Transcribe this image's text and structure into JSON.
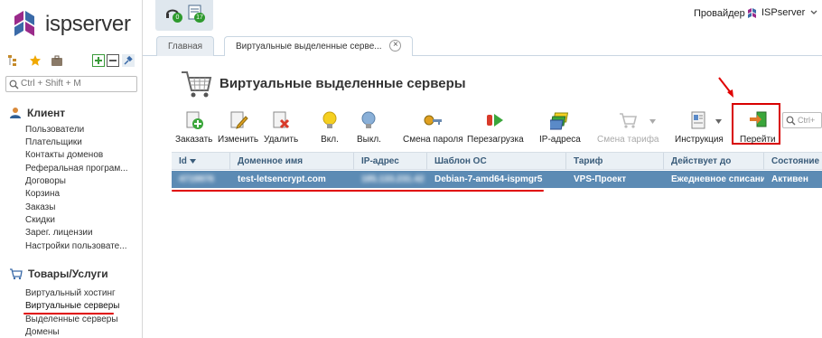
{
  "app": {
    "logo_text": "ispserver",
    "accent": "#7a1a7a"
  },
  "header": {
    "notify_badges": [
      "0",
      "17"
    ],
    "provider_label": "Провайдер",
    "brand_label": "ISPserver"
  },
  "tabs": [
    {
      "label": "Главная"
    },
    {
      "label": "Виртуальные выделенные серве..."
    }
  ],
  "sidebar": {
    "search_placeholder": "Ctrl + Shift + M",
    "sections": [
      {
        "title": "Клиент",
        "icon": "person-icon",
        "items": [
          "Пользователи",
          "Плательщики",
          "Контакты доменов",
          "Реферальная програм...",
          "Договоры",
          "Корзина",
          "Заказы",
          "Скидки",
          "Зарег. лицензии",
          "Настройки пользовате..."
        ]
      },
      {
        "title": "Товары/Услуги",
        "icon": "cart-icon",
        "items": [
          "Виртуальный хостинг",
          "Виртуальные серверы",
          "Выделенные серверы",
          "Домены"
        ]
      }
    ]
  },
  "page": {
    "title": "Виртуальные выделенные серверы"
  },
  "toolbar": {
    "buttons": [
      {
        "label": "Заказать",
        "icon": "order-icon"
      },
      {
        "label": "Изменить",
        "icon": "edit-icon"
      },
      {
        "label": "Удалить",
        "icon": "delete-icon"
      },
      {
        "label": "Вкл.",
        "icon": "bulb-on-icon"
      },
      {
        "label": "Выкл.",
        "icon": "bulb-off-icon"
      },
      {
        "label": "Смена пароля",
        "icon": "key-icon"
      },
      {
        "label": "Перезагрузка",
        "icon": "reboot-icon"
      },
      {
        "label": "IP-адреса",
        "icon": "ip-cards-icon"
      },
      {
        "label": "Смена тарифа",
        "icon": "cart-tariff-icon"
      },
      {
        "label": "Инструкция",
        "icon": "instruction-icon"
      },
      {
        "label": "Перейти",
        "icon": "goto-icon"
      }
    ],
    "search_placeholder": "Ctrl+"
  },
  "table": {
    "columns": [
      "Id",
      "Доменное имя",
      "IP-адрес",
      "Шаблон ОС",
      "Тариф",
      "Действует до",
      "Состояние"
    ],
    "rows": [
      [
        "4719976",
        "test-letsencrypt.com",
        "185.133.231.42",
        "Debian-7-amd64-ispmgr5",
        "VPS-Проект",
        "Ежедневное списание",
        "Активен"
      ]
    ]
  }
}
